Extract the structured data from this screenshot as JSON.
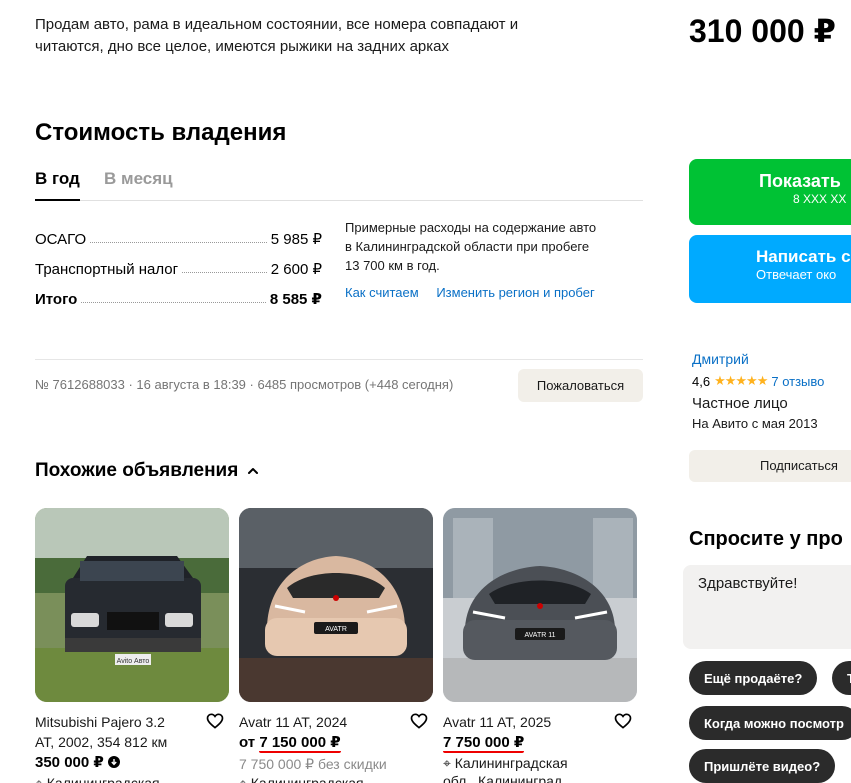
{
  "description": {
    "line1": "Продам авто, рама в идеальном состоянии, все номера совпадают и",
    "line2": "читаются, дно все целое, имеются рыжики на задних арках"
  },
  "ownership": {
    "title": "Стоимость владения",
    "tabs": [
      "В год",
      "В месяц"
    ],
    "rows": [
      {
        "label": "ОСАГО",
        "value": "5 985 ₽"
      },
      {
        "label": "Транспортный налог",
        "value": "2 600 ₽"
      },
      {
        "label": "Итого",
        "value": "8 585 ₽"
      }
    ],
    "note_line1": "Примерные расходы на содержание авто",
    "note_line2": "в Калининградской области при пробеге",
    "note_line3": "13 700 км в год.",
    "link_how": "Как считаем",
    "link_change": "Изменить регион и пробег"
  },
  "listing_meta": {
    "text": "№ 7612688033 · 16 августа в 18:39 · 6485 просмотров (+448 сегодня)",
    "complain_label": "Пожаловаться"
  },
  "similar": {
    "title": "Похожие объявления",
    "cards": [
      {
        "title_line1": "Mitsubishi Pajero 3.2",
        "title_line2": "AT, 2002, 354 812 км",
        "price": "350 000 ₽",
        "old_price": "",
        "location": "Калининградская",
        "image_caption": "Avito Авто"
      },
      {
        "title_line1": "Avatr 11 AT, 2024",
        "title_line2": "",
        "price_prefix": "от",
        "price": "7 150 000 ₽",
        "old_price": "7 750 000 ₽ без скидки",
        "location": "Калининградская",
        "image_caption": "AVATR"
      },
      {
        "title_line1": "Avatr 11 AT, 2025",
        "title_line2": "",
        "price": "7 750 000 ₽",
        "old_price": "",
        "location_line1": "Калининградская",
        "location_line2": "обл., Калининград",
        "image_caption": "AVATR 11"
      }
    ]
  },
  "sidebar": {
    "price": "310 000 ₽",
    "show_phone_label": "Показать",
    "show_phone_sub": "8 XXX XX",
    "message_label": "Написать с",
    "message_sub": "Отвечает око",
    "seller_name": "Дмитрий",
    "rating": "4,6",
    "stars": "★★★★★",
    "reviews": "7 отзыво",
    "seller_type": "Частное лицо",
    "seller_since": "На Авито с мая 2013",
    "subscribe_label": "Подписаться",
    "ask_title": "Спросите у про",
    "ask_placeholder": "Здравствуйте!",
    "chips": [
      "Ещё продаёте?",
      "Т",
      "Когда можно посмотр",
      "Пришлёте видео?"
    ]
  },
  "colors": {
    "green": "#00c234",
    "blue": "#00aaff",
    "link": "#0a70c6",
    "star": "#ffb21e",
    "highlight_red": "#e00000"
  }
}
